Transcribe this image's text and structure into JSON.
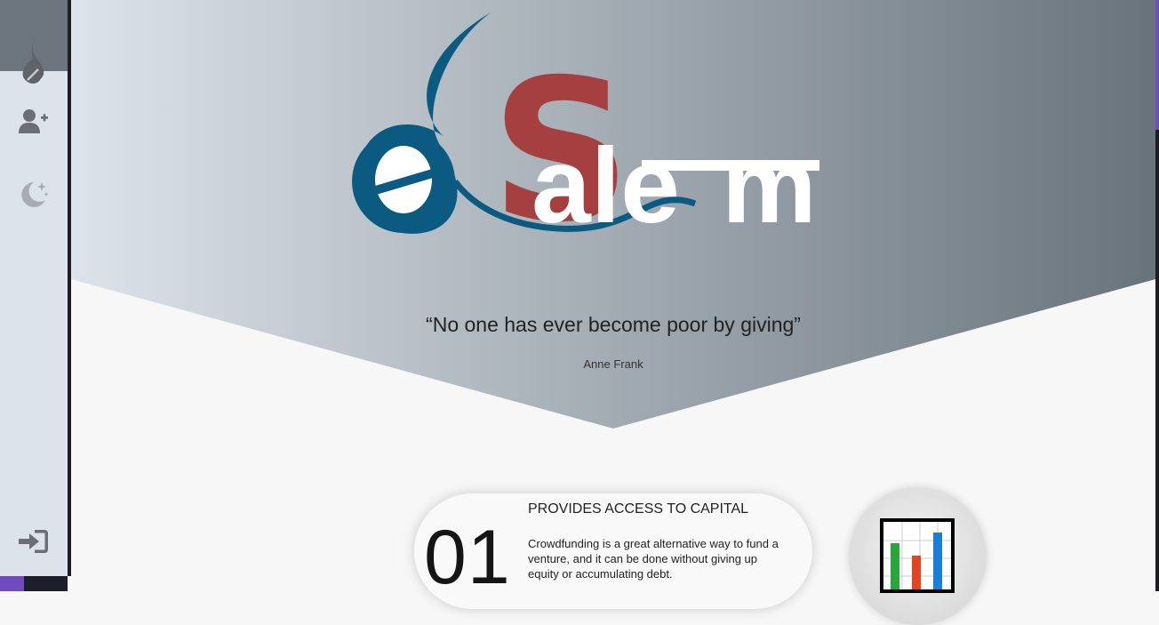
{
  "brand": {
    "name": "Salem"
  },
  "sidebar": {
    "items": [
      {
        "name": "logo",
        "icon": "drop-logo-icon"
      },
      {
        "name": "register",
        "icon": "user-plus-icon"
      },
      {
        "name": "theme",
        "icon": "moon-stars-icon"
      },
      {
        "name": "login",
        "icon": "sign-in-icon"
      }
    ]
  },
  "hero": {
    "quote": "“No one has ever become poor by giving”",
    "author": "Anne Frank"
  },
  "features": [
    {
      "number": "01",
      "title": "PROVIDES ACCESS TO CAPITAL",
      "description": "Crowdfunding is a great alternative way to fund a venture, and it can be done without giving up equity or accumulating debt.",
      "icon": "bar-chart-icon"
    }
  ],
  "colors": {
    "accent": "#6f4bbf",
    "logo_blue": "#0a5a82",
    "logo_red": "#a64040",
    "sidebar": "#dde3ea"
  }
}
